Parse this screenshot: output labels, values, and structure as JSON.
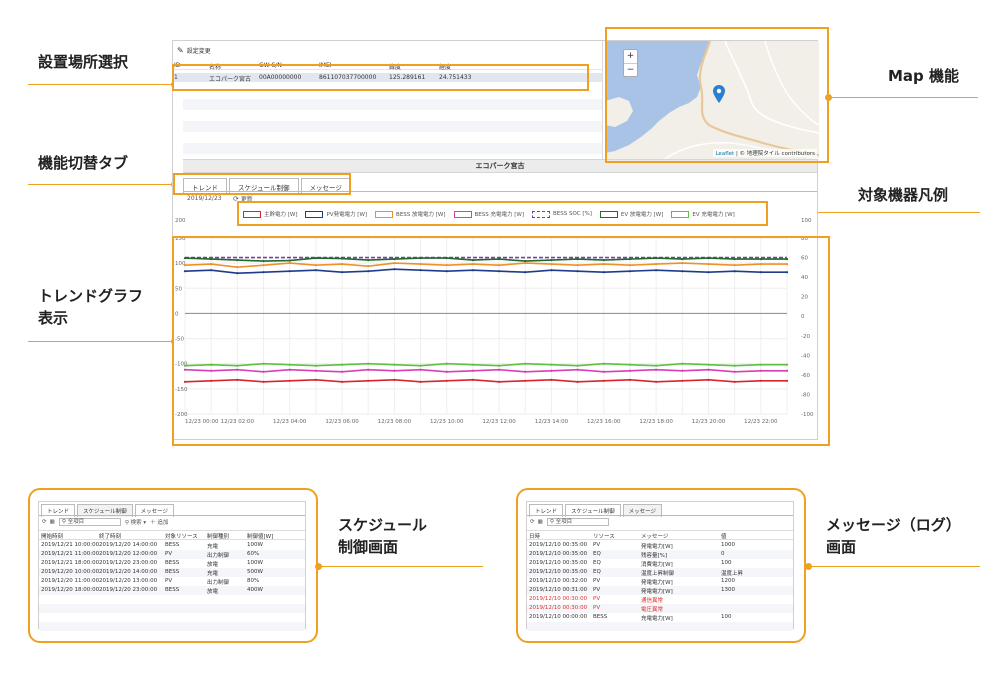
{
  "callouts": {
    "location": "設置場所選択",
    "tabs": "機能切替タブ",
    "trend": [
      "トレンドグラフ",
      "表示"
    ],
    "map": "Map 機能",
    "legend": "対象機器凡例",
    "schedule": [
      "スケジュール",
      "制御画面"
    ],
    "message": [
      "メッセージ（ログ）",
      "画面"
    ]
  },
  "site_panel": {
    "toolbar_label": "設定変更",
    "columns": [
      "ID",
      "名称",
      "GW-S/N",
      "IMEI",
      "緯度",
      "経度"
    ],
    "rows": [
      [
        "1",
        "エコパーク宮古",
        "00A00000000",
        "861107037700000",
        "125.289161",
        "24.751433"
      ]
    ]
  },
  "map": {
    "zoom_in": "+",
    "zoom_out": "−",
    "attribution_link": "Leaflet",
    "attribution_text": "| © 地理院タイル contributors"
  },
  "main": {
    "site_title": "エコパーク宮古",
    "tabs": [
      "トレンド",
      "スケジュール制御",
      "メッセージ"
    ],
    "date": "2019/12/23",
    "refresh_label": "更新"
  },
  "legend_items": [
    {
      "label": "主幹電力 [W]",
      "color": "#d9232e"
    },
    {
      "label": "PV発電電力 [W]",
      "color": "#1f3b8c"
    },
    {
      "label": "BESS 放電電力 [W]",
      "color": "#f0902a"
    },
    {
      "label": "BESS 充電電力 [W]",
      "color": "#d63fb8"
    },
    {
      "label": "BESS SOC [%]",
      "color": "#7a3fa0"
    },
    {
      "label": "EV 放電電力 [W]",
      "color": "#1e6b2a"
    },
    {
      "label": "EV 充電電力 [W]",
      "color": "#5cc03e"
    }
  ],
  "trend_axes": {
    "left_ticks": [
      "200",
      "150",
      "100",
      "50",
      "0",
      "-50",
      "-100",
      "-150",
      "-200"
    ],
    "right_ticks": [
      "100",
      "80",
      "60",
      "40",
      "20",
      "0",
      "-20",
      "-40",
      "-60",
      "-80",
      "-100"
    ],
    "x_ticks": [
      "12/23 00:00",
      "12/23 02:00",
      "12/23 04:00",
      "12/23 06:00",
      "12/23 08:00",
      "12/23 10:00",
      "12/23 12:00",
      "12/23 14:00",
      "12/23 16:00",
      "12/23 18:00",
      "12/23 20:00",
      "12/23 22:00"
    ]
  },
  "chart_data": {
    "type": "line",
    "x": [
      "12/23 00:00",
      "12/23 01:00",
      "12/23 02:00",
      "12/23 03:00",
      "12/23 04:00",
      "12/23 05:00",
      "12/23 06:00",
      "12/23 07:00",
      "12/23 08:00",
      "12/23 09:00",
      "12/23 10:00",
      "12/23 11:00",
      "12/23 12:00",
      "12/23 13:00",
      "12/23 14:00",
      "12/23 15:00",
      "12/23 16:00",
      "12/23 17:00",
      "12/23 18:00",
      "12/23 19:00",
      "12/23 20:00",
      "12/23 21:00",
      "12/23 22:00",
      "12/23 23:00"
    ],
    "ylim_left": [
      -200,
      150
    ],
    "ylim_right": [
      -100,
      80
    ],
    "series": [
      {
        "name": "BESS SOC [%]",
        "axis": "right",
        "color": "#7a3fa0",
        "dashed": true,
        "values": [
          60,
          60,
          60,
          60,
          60,
          60,
          60,
          60,
          60,
          60,
          60,
          60,
          60,
          60,
          60,
          60,
          60,
          60,
          60,
          60,
          60,
          60,
          60,
          60
        ]
      },
      {
        "name": "EV 放電電力 [W]",
        "axis": "left",
        "color": "#1e6b2a",
        "values": [
          110,
          108,
          106,
          104,
          105,
          110,
          109,
          106,
          108,
          110,
          110,
          106,
          108,
          104,
          106,
          108,
          106,
          108,
          110,
          108,
          110,
          108,
          108,
          108
        ]
      },
      {
        "name": "BESS 放電電力 [W]",
        "axis": "left",
        "color": "#f0902a",
        "values": [
          96,
          98,
          92,
          96,
          100,
          96,
          98,
          94,
          100,
          98,
          96,
          98,
          96,
          100,
          98,
          96,
          98,
          96,
          98,
          100,
          98,
          96,
          98,
          98
        ]
      },
      {
        "name": "PV発電電力 [W]",
        "axis": "left",
        "color": "#1f3b8c",
        "values": [
          84,
          86,
          80,
          82,
          84,
          86,
          82,
          84,
          88,
          86,
          84,
          86,
          84,
          82,
          86,
          84,
          82,
          84,
          86,
          84,
          82,
          84,
          82,
          82
        ]
      },
      {
        "name": "EV 充電電力 [W]",
        "axis": "left",
        "color": "#5cc03e",
        "values": [
          -104,
          -102,
          -104,
          -100,
          -102,
          -104,
          -102,
          -100,
          -102,
          -104,
          -100,
          -102,
          -104,
          -100,
          -102,
          -104,
          -100,
          -102,
          -104,
          -100,
          -102,
          -104,
          -102,
          -102
        ]
      },
      {
        "name": "BESS 充電電力 [W]",
        "axis": "left",
        "color": "#d63fb8",
        "values": [
          -112,
          -114,
          -112,
          -116,
          -112,
          -114,
          -116,
          -112,
          -114,
          -112,
          -116,
          -114,
          -112,
          -116,
          -114,
          -112,
          -116,
          -114,
          -112,
          -114,
          -112,
          -116,
          -114,
          -114
        ]
      },
      {
        "name": "主幹電力 [W]",
        "axis": "left",
        "color": "#d9232e",
        "values": [
          -136,
          -134,
          -132,
          -136,
          -134,
          -132,
          -136,
          -134,
          -132,
          -136,
          -134,
          -132,
          -136,
          -134,
          -132,
          -136,
          -134,
          -132,
          -136,
          -134,
          -132,
          -136,
          -134,
          -134
        ]
      }
    ]
  },
  "schedule_panel": {
    "tabs": [
      "トレンド",
      "スケジュール制御",
      "メッセージ"
    ],
    "search_placeholder": "全項目",
    "search_button": "検索",
    "add_label": "追加",
    "columns": [
      "開始時刻",
      "終了時刻",
      "対象リソース",
      "制御種別",
      "制御値[W]"
    ],
    "rows": [
      [
        "2019/12/21 10:00:00",
        "2019/12/20 14:00:00",
        "BESS",
        "充電",
        "100W"
      ],
      [
        "2019/12/21 11:00:00",
        "2019/12/20 12:00:00",
        "PV",
        "出力制御",
        "60%"
      ],
      [
        "2019/12/21 18:00:00",
        "2019/12/20 23:00:00",
        "BESS",
        "放電",
        "100W"
      ],
      [
        "2019/12/20 10:00:00",
        "2019/12/20 14:00:00",
        "BESS",
        "充電",
        "500W"
      ],
      [
        "2019/12/20 11:00:00",
        "2019/12/20 13:00:00",
        "PV",
        "出力制御",
        "80%"
      ],
      [
        "2019/12/20 18:00:00",
        "2019/12/20 23:00:00",
        "BESS",
        "放電",
        "400W"
      ]
    ]
  },
  "message_panel": {
    "tabs": [
      "トレンド",
      "スケジュール制御",
      "メッセージ"
    ],
    "search_placeholder": "全項目",
    "columns": [
      "日時",
      "リソース",
      "メッセージ",
      "値"
    ],
    "rows": [
      {
        "cells": [
          "2019/12/10 00:35:00",
          "PV",
          "発電電力[W]",
          "1000"
        ],
        "alert": false
      },
      {
        "cells": [
          "2019/12/10 00:35:00",
          "EQ",
          "残容量[%]",
          "0"
        ],
        "alert": false
      },
      {
        "cells": [
          "2019/12/10 00:35:00",
          "EQ",
          "消費電力[W]",
          "100"
        ],
        "alert": false
      },
      {
        "cells": [
          "2019/12/10 00:35:00",
          "EQ",
          "温度上昇制御",
          "温度上昇"
        ],
        "alert": false
      },
      {
        "cells": [
          "2019/12/10 00:32:00",
          "PV",
          "発電電力[W]",
          "1200"
        ],
        "alert": false
      },
      {
        "cells": [
          "2019/12/10 00:31:00",
          "PV",
          "発電電力[W]",
          "1300"
        ],
        "alert": false
      },
      {
        "cells": [
          "2019/12/10 00:30:00",
          "PV",
          "通信異常",
          ""
        ],
        "alert": true
      },
      {
        "cells": [
          "2019/12/10 00:30:00",
          "PV",
          "電圧異常",
          ""
        ],
        "alert": true
      },
      {
        "cells": [
          "2019/12/10 00:00:00",
          "BESS",
          "充電電力[W]",
          "100"
        ],
        "alert": false
      }
    ]
  }
}
